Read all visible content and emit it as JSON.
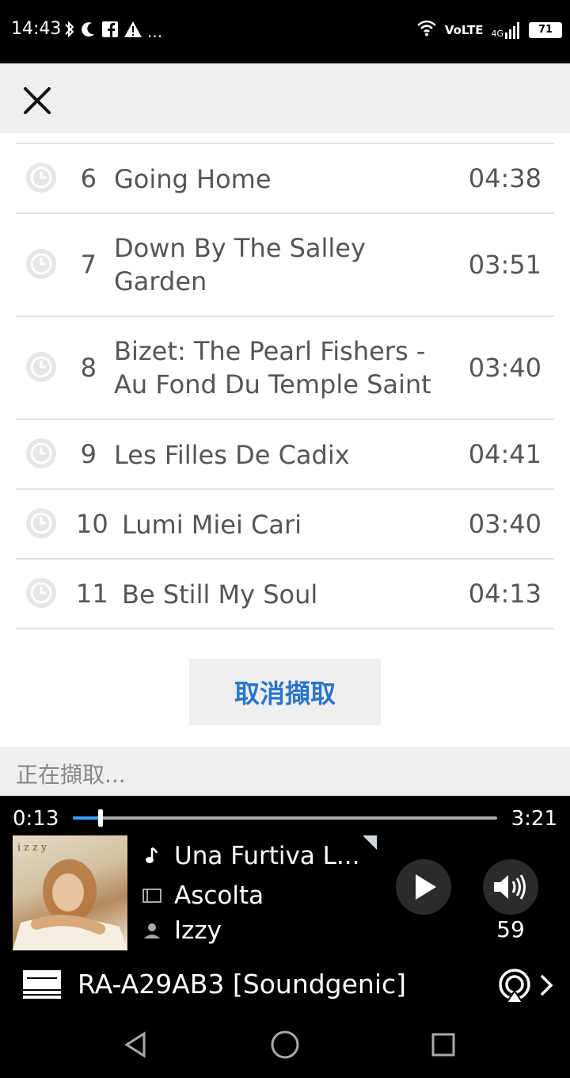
{
  "status_bar": {
    "time": "14:43",
    "left_icons": [
      "bluetooth-icon",
      "moon-icon",
      "facebook-icon",
      "warning-icon",
      "more-icon"
    ],
    "dots": "...",
    "volte": "VoLTE",
    "signal": "4G",
    "battery": "71"
  },
  "header": {
    "close_icon": "close-icon"
  },
  "tracks": [
    {
      "num": "6",
      "title": "Going Home",
      "duration": "04:38"
    },
    {
      "num": "7",
      "title": "Down By The Salley Garden",
      "duration": "03:51"
    },
    {
      "num": "8",
      "title": "Bizet: The Pearl Fishers - Au Fond Du Temple Saint",
      "duration": "03:40"
    },
    {
      "num": "9",
      "title": "Les Filles De Cadix",
      "duration": "04:41"
    },
    {
      "num": "10",
      "title": "Lumi Miei Cari",
      "duration": "03:40"
    },
    {
      "num": "11",
      "title": "Be Still My Soul",
      "duration": "04:13"
    }
  ],
  "cancel_button": "取消擷取",
  "extracting_label": "正在擷取...",
  "player": {
    "elapsed": "0:13",
    "total": "3:21",
    "progress_fraction": 0.065,
    "album_art_text": "izzy",
    "song": "Una Furtiva L...",
    "album": "Ascolta",
    "artist": "Izzy",
    "volume": "59",
    "device": "RA-A29AB3 [Soundgenic]"
  },
  "colors": {
    "accent": "#2a74c9",
    "progress": "#3aa0ff",
    "text_secondary": "#555555"
  }
}
